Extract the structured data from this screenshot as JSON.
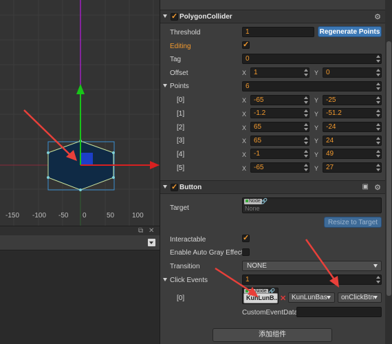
{
  "scene": {
    "ruler_labels": [
      "-150",
      "-100",
      "-50",
      "0",
      "50",
      "100"
    ]
  },
  "polygon_collider": {
    "title": "PolygonCollider",
    "threshold_label": "Threshold",
    "threshold_value": "1",
    "regenerate_label": "Regenerate Points",
    "editing_label": "Editing",
    "editing_checked": true,
    "tag_label": "Tag",
    "tag_value": "0",
    "offset_label": "Offset",
    "offset_x": "1",
    "offset_y": "0",
    "x_label": "X",
    "y_label": "Y",
    "points_label": "Points",
    "points_count": "6",
    "points": [
      {
        "index": "[0]",
        "x": "-65",
        "y": "-25"
      },
      {
        "index": "[1]",
        "x": "-1.2",
        "y": "-51.2"
      },
      {
        "index": "[2]",
        "x": "65",
        "y": "-24"
      },
      {
        "index": "[3]",
        "x": "65",
        "y": "24"
      },
      {
        "index": "[4]",
        "x": "-1",
        "y": "49"
      },
      {
        "index": "[5]",
        "x": "-65",
        "y": "27"
      }
    ]
  },
  "button_component": {
    "title": "Button",
    "target_label": "Target",
    "target_tag": "Node",
    "target_value": "None",
    "resize_label": "Resize to Target",
    "interactable_label": "Interactable",
    "interactable_checked": true,
    "gray_label": "Enable Auto Gray Effect",
    "gray_checked": false,
    "transition_label": "Transition",
    "transition_value": "NONE",
    "click_events_label": "Click Events",
    "click_events_count": "1",
    "event": {
      "index": "[0]",
      "node_tag": "cc.Node",
      "node_value": "KunLunB...",
      "component": "KunLunBas",
      "handler": "onClickBtn",
      "custom_label": "CustomEventData",
      "custom_value": ""
    }
  },
  "add_component_label": "添加组件",
  "colors": {
    "accent_orange": "#f39a2e",
    "button_blue": "#3c78b5",
    "annotation_red": "#e8403a"
  }
}
